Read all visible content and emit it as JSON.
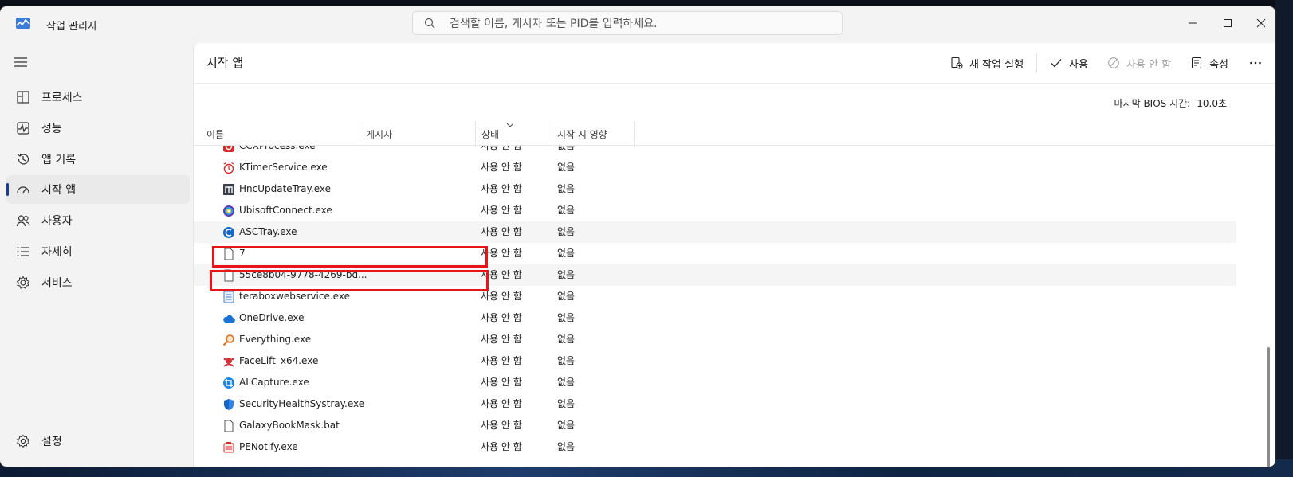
{
  "window": {
    "title": "작업 관리자"
  },
  "search": {
    "placeholder": "검색할 이름, 게시자 또는 PID를 입력하세요."
  },
  "sidebar": {
    "items": [
      {
        "label": "프로세스",
        "icon": "processes-icon"
      },
      {
        "label": "성능",
        "icon": "performance-icon"
      },
      {
        "label": "앱 기록",
        "icon": "app-history-icon"
      },
      {
        "label": "시작 앱",
        "icon": "startup-apps-icon",
        "active": true
      },
      {
        "label": "사용자",
        "icon": "users-icon"
      },
      {
        "label": "자세히",
        "icon": "details-icon"
      },
      {
        "label": "서비스",
        "icon": "services-icon"
      }
    ],
    "settings_label": "설정"
  },
  "page": {
    "title": "시작 앱"
  },
  "toolbar": {
    "new_task_label": "새 작업 실행",
    "enable_label": "사용",
    "disable_label": "사용 안 함",
    "properties_label": "속성"
  },
  "bios": {
    "label": "마지막 BIOS 시간:",
    "value": "10.0초"
  },
  "table": {
    "columns": {
      "name": "이름",
      "publisher": "게시자",
      "status": "상태",
      "impact": "시작 시 영향"
    },
    "rows": [
      {
        "name": "CCXProcess.exe",
        "publisher": "",
        "status": "사용 안 함",
        "impact": "없음",
        "icon": "ccx-icon"
      },
      {
        "name": "KTimerService.exe",
        "publisher": "",
        "status": "사용 안 함",
        "impact": "없음",
        "icon": "alarm-clock-icon"
      },
      {
        "name": "HncUpdateTray.exe",
        "publisher": "",
        "status": "사용 안 함",
        "impact": "없음",
        "icon": "hnc-update-icon"
      },
      {
        "name": "UbisoftConnect.exe",
        "publisher": "",
        "status": "사용 안 함",
        "impact": "없음",
        "icon": "ubisoft-icon"
      },
      {
        "name": "ASCTray.exe",
        "publisher": "",
        "status": "사용 안 함",
        "impact": "없음",
        "icon": "asc-icon"
      },
      {
        "name": "7",
        "publisher": "",
        "status": "사용 안 함",
        "impact": "없음",
        "icon": "file-icon"
      },
      {
        "name": "55ce8b04-9778-4269-bd...",
        "publisher": "",
        "status": "사용 안 함",
        "impact": "없음",
        "icon": "file-icon"
      },
      {
        "name": "teraboxwebservice.exe",
        "publisher": "",
        "status": "사용 안 함",
        "impact": "없음",
        "icon": "terabox-icon"
      },
      {
        "name": "OneDrive.exe",
        "publisher": "",
        "status": "사용 안 함",
        "impact": "없음",
        "icon": "onedrive-cloud-icon"
      },
      {
        "name": "Everything.exe",
        "publisher": "",
        "status": "사용 안 함",
        "impact": "없음",
        "icon": "magnifier-icon"
      },
      {
        "name": "FaceLift_x64.exe",
        "publisher": "",
        "status": "사용 안 함",
        "impact": "없음",
        "icon": "facelift-icon"
      },
      {
        "name": "ALCapture.exe",
        "publisher": "",
        "status": "사용 안 함",
        "impact": "없음",
        "icon": "alcapture-icon"
      },
      {
        "name": "SecurityHealthSystray.exe",
        "publisher": "",
        "status": "사용 안 함",
        "impact": "없음",
        "icon": "shield-icon"
      },
      {
        "name": "GalaxyBookMask.bat",
        "publisher": "",
        "status": "사용 안 함",
        "impact": "없음",
        "icon": "file-icon"
      },
      {
        "name": "PENotify.exe",
        "publisher": "",
        "status": "사용 안 함",
        "impact": "없음",
        "icon": "penotify-icon"
      }
    ]
  },
  "colors": {
    "accent": "#1b3f8f",
    "highlight": "#e8141a"
  }
}
